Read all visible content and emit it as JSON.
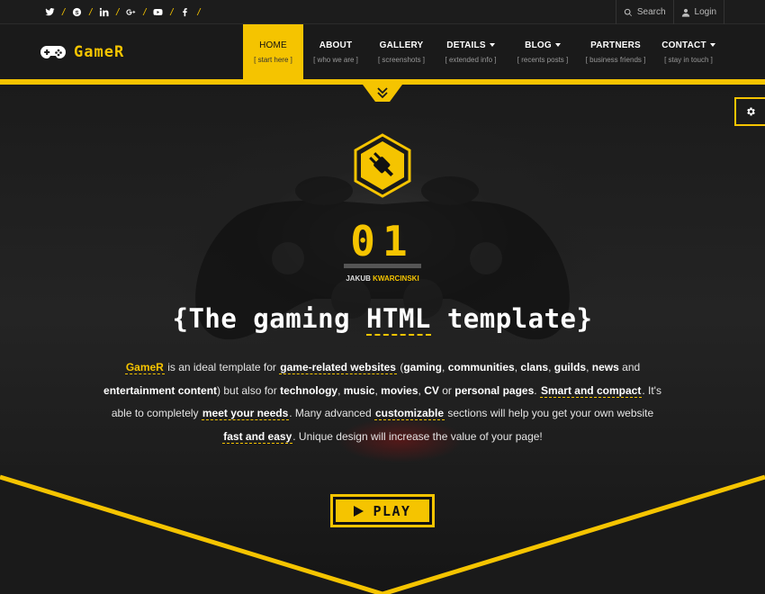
{
  "topbar": {
    "socials": [
      {
        "name": "twitter"
      },
      {
        "name": "skype"
      },
      {
        "name": "linkedin"
      },
      {
        "name": "google-plus"
      },
      {
        "name": "youtube"
      },
      {
        "name": "facebook"
      }
    ],
    "separator": "/",
    "search_label": "Search",
    "login_label": "Login"
  },
  "logo": {
    "text": "GameR",
    "icon": "gamepad-icon"
  },
  "nav": {
    "items": [
      {
        "label": "HOME",
        "sub": "[ start here ]",
        "active": true
      },
      {
        "label": "ABOUT",
        "sub": "[ who we are ]"
      },
      {
        "label": "GALLERY",
        "sub": "[ screenshots ]"
      },
      {
        "label": "DETAILS",
        "sub": "[ extended info ]",
        "dropdown": true
      },
      {
        "label": "BLOG",
        "sub": "[ recents posts ]",
        "dropdown": true
      },
      {
        "label": "PARTNERS",
        "sub": "[ business friends ]"
      },
      {
        "label": "CONTACT",
        "sub": "[ stay in touch ]",
        "dropdown": true
      }
    ]
  },
  "hero": {
    "number": "01",
    "author_first": "JAKUB",
    "author_last": "KWARCINSKI",
    "headline_pre": "{The gaming",
    "headline_highlight": "HTML",
    "headline_post": "template}",
    "desc": {
      "brand": "GameR",
      "t1": "is an ideal template for",
      "k1": "game-related websites",
      "t2": "(",
      "b1": "gaming",
      "c1": ",",
      "b2": "communities",
      "c2": ",",
      "b3": "clans",
      "c3": ",",
      "b4": "guilds",
      "c4": ",",
      "b5": "news",
      "t3": "and",
      "b6": "entertainment content",
      "t4": ") but also for",
      "b7": "technology",
      "c5": ",",
      "b8": "music",
      "c6": ",",
      "b9": "movies",
      "c7": ",",
      "b10": "CV",
      "t5": "or",
      "b11": "personal pages",
      "t6": ".",
      "k2": "Smart and compact",
      "t7": ". It's able to completely",
      "k3": "meet your needs",
      "t8": ". Many advanced",
      "k4": "customizable",
      "t9": "sections will help you get your own website",
      "k5": "fast and easy",
      "t10": ". Unique design will increase the value of your page!"
    },
    "play_label": "PLAY"
  },
  "colors": {
    "accent": "#f5c400",
    "dark": "#1a1a1a"
  }
}
